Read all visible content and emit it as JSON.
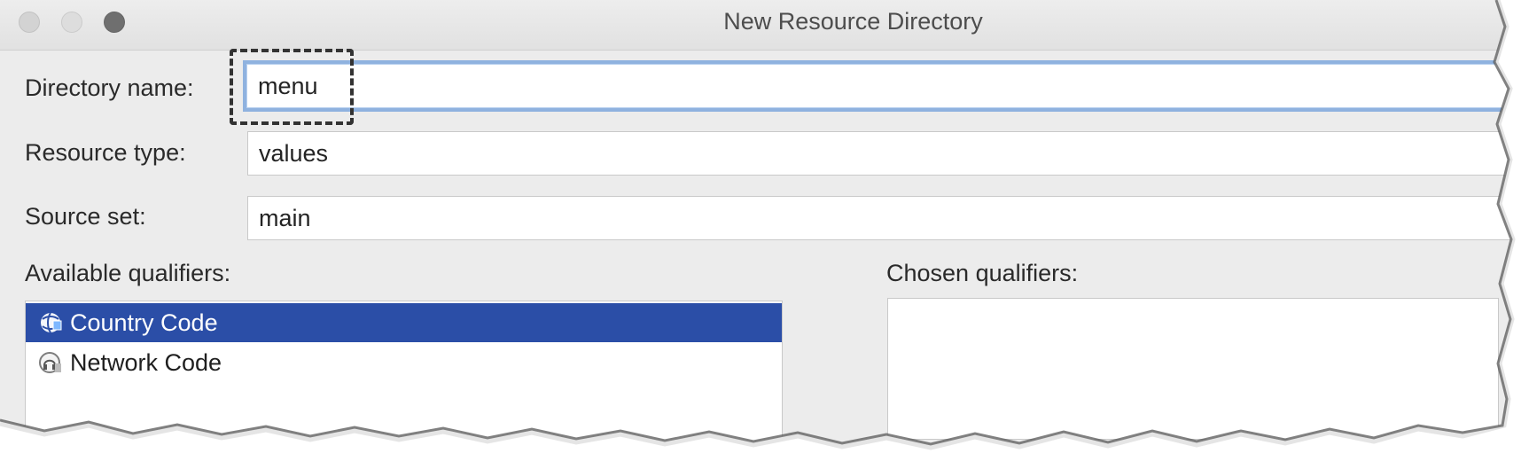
{
  "window": {
    "title": "New Resource Directory"
  },
  "form": {
    "directory_name_label": "Directory name:",
    "directory_name_value": "menu",
    "resource_type_label": "Resource type:",
    "resource_type_value": "values",
    "source_set_label": "Source set:",
    "source_set_value": "main"
  },
  "qualifiers": {
    "available_label": "Available qualifiers:",
    "chosen_label": "Chosen qualifiers:",
    "available_items": [
      {
        "label": "Country Code",
        "icon": "country-code-icon",
        "selected": true
      },
      {
        "label": "Network Code",
        "icon": "network-code-icon",
        "selected": false
      }
    ],
    "chosen_items": []
  },
  "colors": {
    "selection": "#2b4ea7",
    "focus_ring": "#8fb2df",
    "window_bg": "#ececec"
  }
}
